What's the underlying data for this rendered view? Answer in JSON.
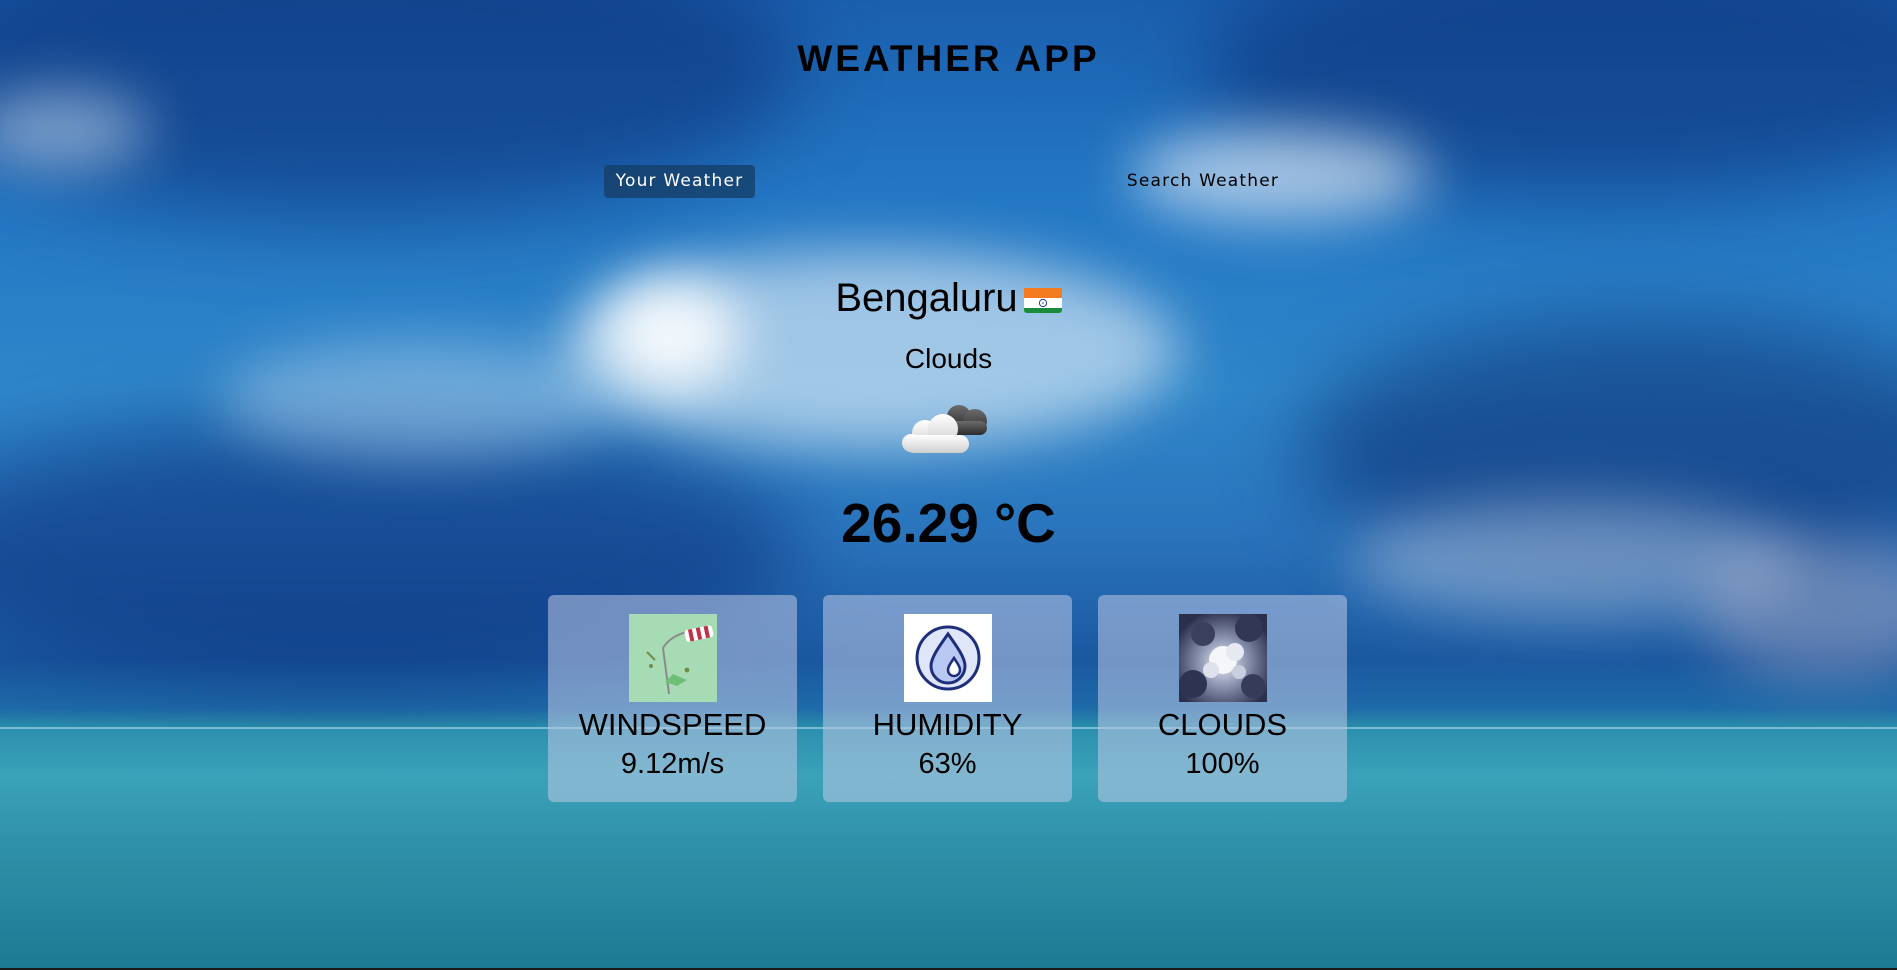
{
  "app": {
    "title": "WEATHER APP"
  },
  "tabs": [
    {
      "label": "Your Weather",
      "active": true
    },
    {
      "label": "Search Weather",
      "active": false
    }
  ],
  "weather": {
    "city": "Bengaluru",
    "country_flag_icon": "india-flag-icon",
    "description": "Clouds",
    "condition_icon": "cloud-icon",
    "temperature": "26.29 °C"
  },
  "stats": [
    {
      "label": "WINDSPEED",
      "value": "9.12m/s",
      "icon": "windsock-icon"
    },
    {
      "label": "HUMIDITY",
      "value": "63%",
      "icon": "humidity-drop-icon"
    },
    {
      "label": "CLOUDS",
      "value": "100%",
      "icon": "clouds-photo-icon"
    }
  ],
  "colors": {
    "active_tab_bg": "#143c64",
    "card_bg": "#bec8e6",
    "sky": "#2377c4",
    "sea": "#2c9ab4"
  }
}
